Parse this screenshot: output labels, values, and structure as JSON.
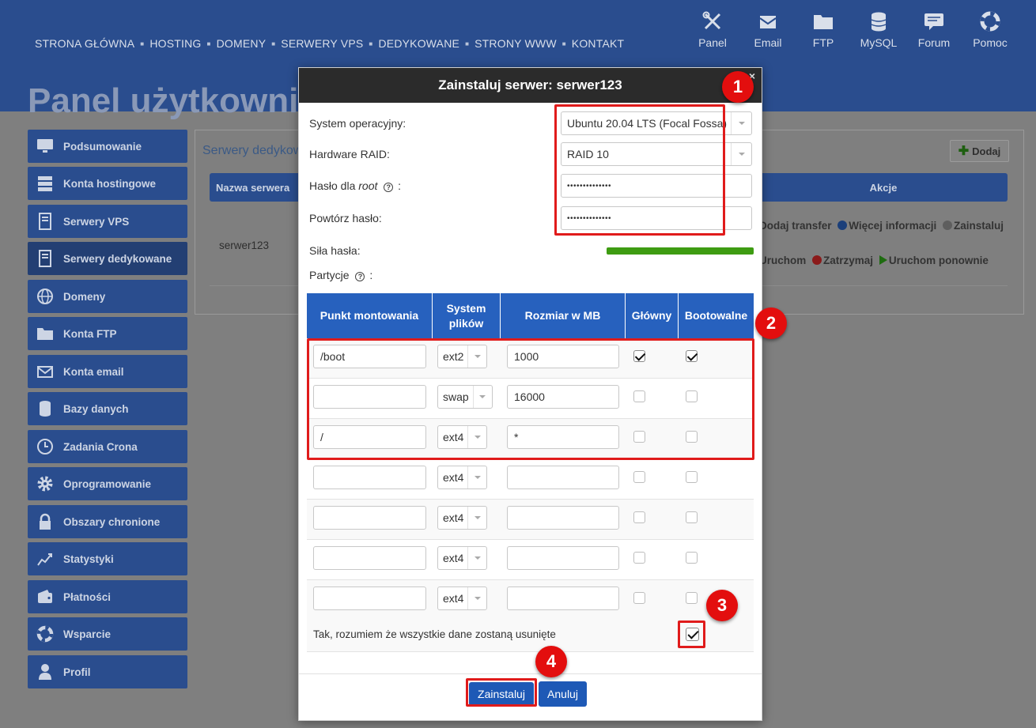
{
  "nav": {
    "items": [
      "STRONA GŁÓWNA",
      "HOSTING",
      "DOMENY",
      "SERWERY VPS",
      "DEDYKOWANE",
      "STRONY WWW",
      "KONTAKT"
    ]
  },
  "top_icons": [
    {
      "label": "Panel",
      "icon": "tools-icon"
    },
    {
      "label": "Email",
      "icon": "email-icon"
    },
    {
      "label": "FTP",
      "icon": "folder-icon"
    },
    {
      "label": "MySQL",
      "icon": "database-icon"
    },
    {
      "label": "Forum",
      "icon": "forum-icon"
    },
    {
      "label": "Pomoc",
      "icon": "lifebuoy-icon"
    }
  ],
  "page_title": "Panel użytkownika",
  "sidebar": {
    "items": [
      {
        "label": "Podsumowanie",
        "icon": "monitor-icon"
      },
      {
        "label": "Konta hostingowe",
        "icon": "server-stack-icon"
      },
      {
        "label": "Serwery VPS",
        "icon": "server-icon"
      },
      {
        "label": "Serwery dedykowane",
        "icon": "server-icon",
        "active": true
      },
      {
        "label": "Domeny",
        "icon": "globe-icon"
      },
      {
        "label": "Konta FTP",
        "icon": "folder-icon"
      },
      {
        "label": "Konta email",
        "icon": "email-icon"
      },
      {
        "label": "Bazy danych",
        "icon": "database-icon"
      },
      {
        "label": "Zadania Crona",
        "icon": "clock-icon"
      },
      {
        "label": "Oprogramowanie",
        "icon": "gear-icon"
      },
      {
        "label": "Obszary chronione",
        "icon": "lock-icon"
      },
      {
        "label": "Statystyki",
        "icon": "chart-icon"
      },
      {
        "label": "Płatności",
        "icon": "wallet-icon"
      },
      {
        "label": "Wsparcie",
        "icon": "lifebuoy-icon"
      },
      {
        "label": "Profil",
        "icon": "user-icon"
      }
    ]
  },
  "content": {
    "title": "Serwery dedykowane",
    "add_label": "Dodaj",
    "col_server": "Nazwa serwera",
    "col_actions": "Akcje",
    "server_name": "serwer123",
    "actions_row1": [
      "Dodaj transfer",
      "Więcej informacji",
      "Zainstaluj"
    ],
    "actions_row2": [
      "Uruchom",
      "Zatrzymaj",
      "Uruchom ponownie"
    ]
  },
  "modal": {
    "title": "Zainstaluj serwer: serwer123",
    "close": "×",
    "os_label": "System operacyjny:",
    "os_value": "Ubuntu 20.04 LTS (Focal Fossa)",
    "raid_label": "Hardware RAID:",
    "raid_value": "RAID 10",
    "pwd_label_pre": "Hasło dla",
    "pwd_label_root": "root",
    "pwd_label_post": ":",
    "pwd_value": "••••••••••••••",
    "pwd2_label": "Powtórz hasło:",
    "pwd2_value": "••••••••••••••",
    "strength_label": "Siła hasła:",
    "password_strength": 1.0,
    "partitions_label": "Partycje",
    "partitions_label_post": ":",
    "help": "?",
    "columns": [
      "Punkt montowania",
      "System plików",
      "Rozmiar w MB",
      "Główny",
      "Bootowalne"
    ],
    "rows": [
      {
        "mount": "/boot",
        "fs": "ext2",
        "size": "1000",
        "main": true,
        "boot": true
      },
      {
        "mount": "",
        "fs": "swap",
        "size": "16000",
        "main": false,
        "boot": false
      },
      {
        "mount": "/",
        "fs": "ext4",
        "size": "*",
        "main": false,
        "boot": false
      },
      {
        "mount": "",
        "fs": "ext4",
        "size": "",
        "main": false,
        "boot": false
      },
      {
        "mount": "",
        "fs": "ext4",
        "size": "",
        "main": false,
        "boot": false
      },
      {
        "mount": "",
        "fs": "ext4",
        "size": "",
        "main": false,
        "boot": false
      },
      {
        "mount": "",
        "fs": "ext4",
        "size": "",
        "main": false,
        "boot": false
      }
    ],
    "confirm_text": "Tak, rozumiem że wszystkie dane zostaną usunięte",
    "confirm_checked": true,
    "install_label": "Zainstaluj",
    "cancel_label": "Anuluj"
  },
  "annotations": [
    "1",
    "2",
    "3",
    "4"
  ],
  "colors": {
    "header_bg": "#2a4d8e",
    "table_head": "#2761be",
    "button": "#1e59b6",
    "annotation_red": "#e30e0e",
    "strength_bar": "#3e9c12"
  }
}
